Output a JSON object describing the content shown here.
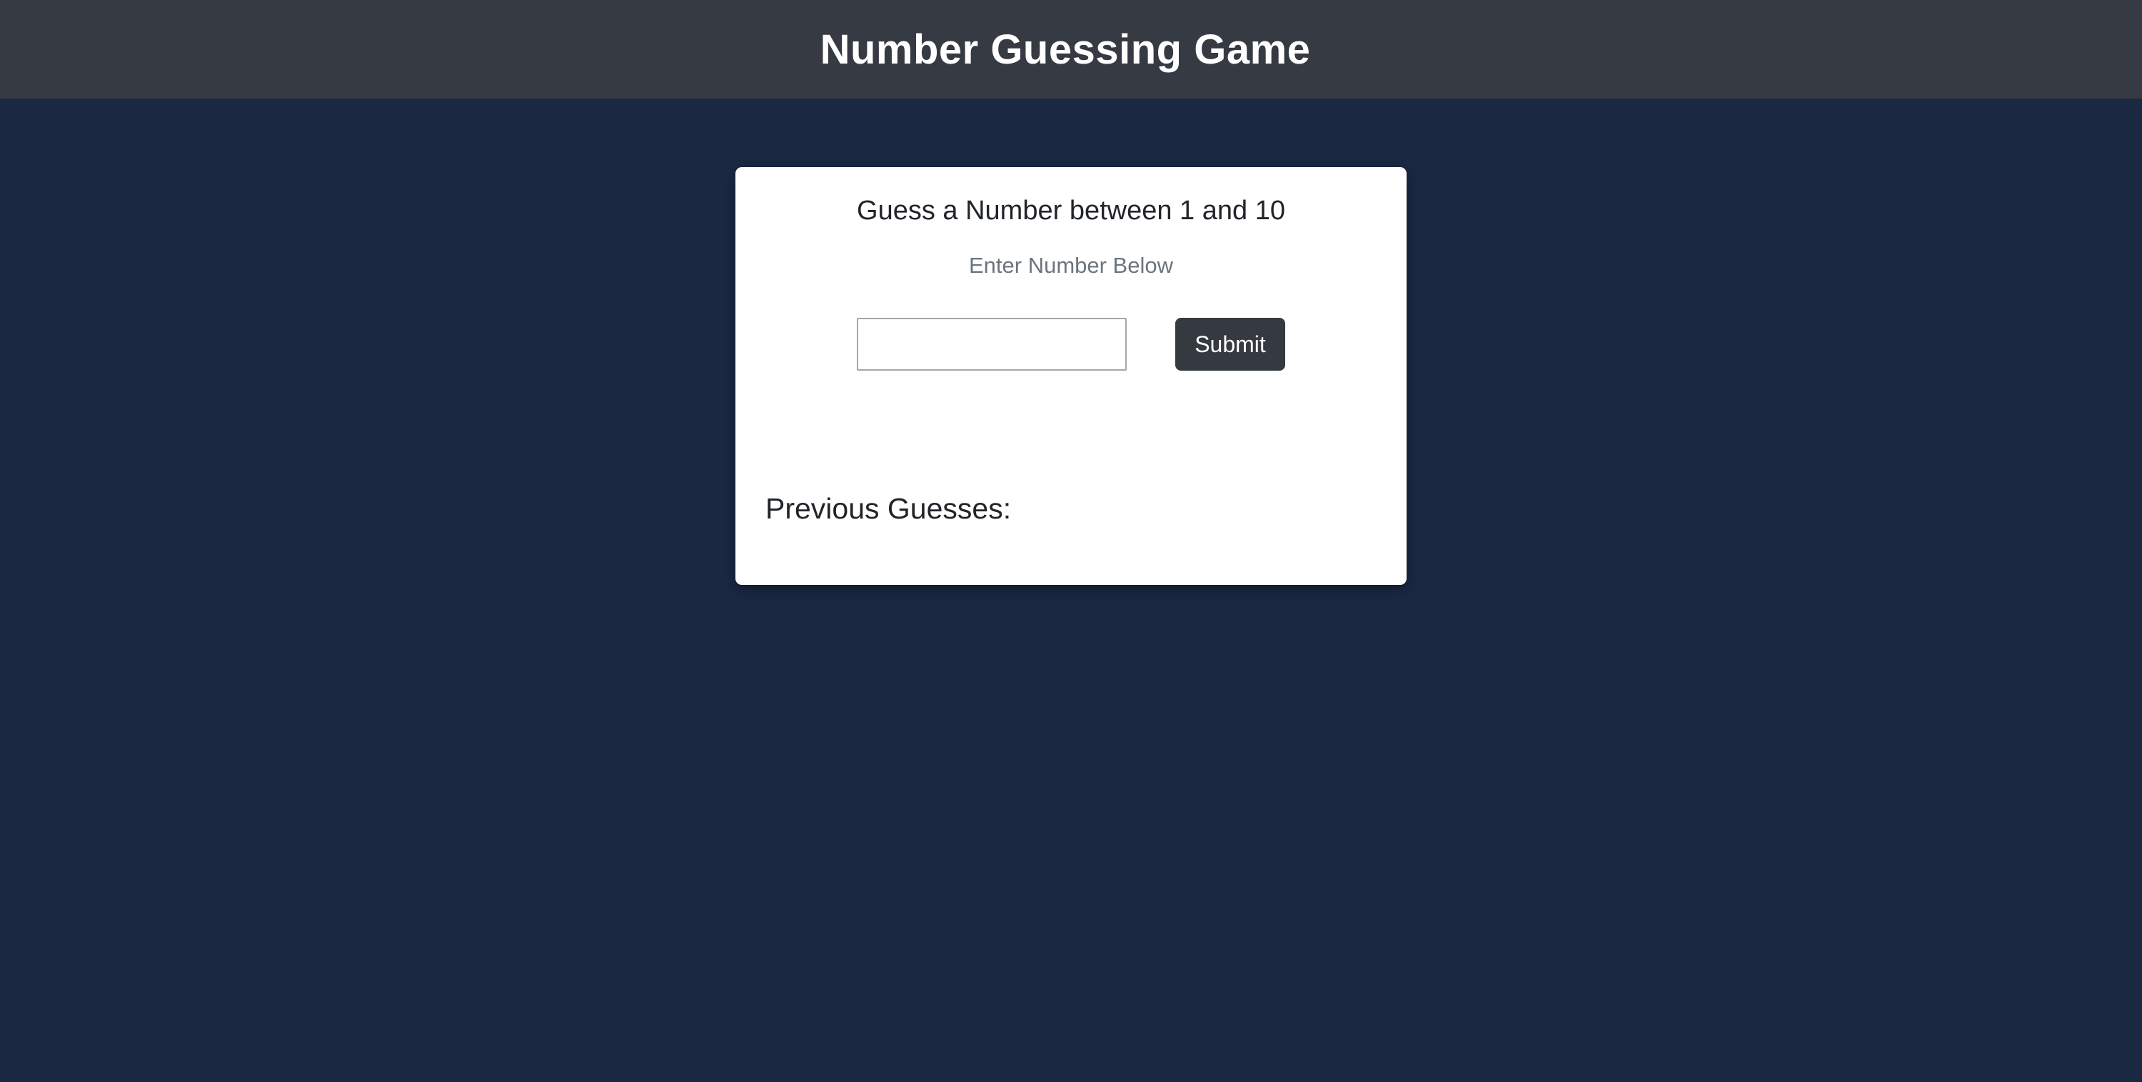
{
  "header": {
    "title": "Number Guessing Game"
  },
  "game": {
    "title": "Guess a Number between 1 and 10",
    "subtitle": "Enter Number Below",
    "input_value": "",
    "submit_label": "Submit",
    "previous_label": "Previous Guesses:",
    "previous_guesses": ""
  },
  "colors": {
    "page_background": "#1a2842",
    "header_background": "#363a42",
    "button_background": "#343a40"
  }
}
